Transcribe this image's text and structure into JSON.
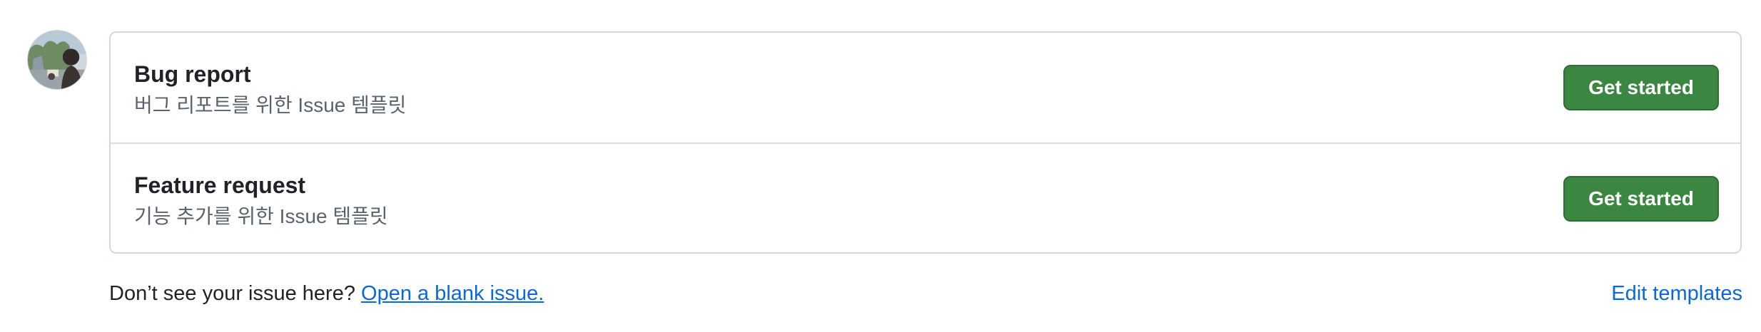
{
  "templates": [
    {
      "title": "Bug report",
      "description": "버그 리포트를 위한 Issue 템플릿",
      "button_label": "Get started"
    },
    {
      "title": "Feature request",
      "description": "기능 추가를 위한 Issue 템플릿",
      "button_label": "Get started"
    }
  ],
  "footer": {
    "prompt": "Don’t see your issue here? ",
    "blank_issue_link": "Open a blank issue.",
    "edit_templates_link": "Edit templates"
  },
  "colors": {
    "primary_button": "#3b8640",
    "link": "#0969da",
    "border": "#d0d7de",
    "muted_text": "#59636e"
  },
  "icons": {
    "avatar": "user-avatar-photo"
  }
}
